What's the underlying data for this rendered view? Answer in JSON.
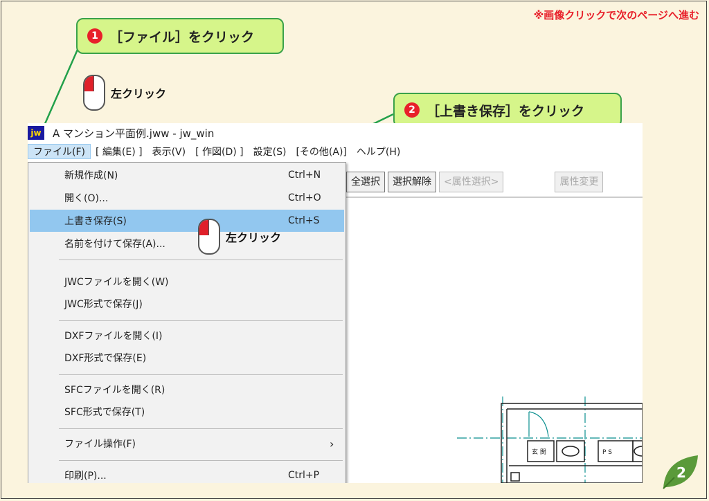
{
  "note": "※画像クリックで次のページへ進む",
  "callout1": {
    "num": "1",
    "text": "［ファイル］をクリック"
  },
  "callout2": {
    "num": "2",
    "text": "［上書き保存］をクリック"
  },
  "mouse_label": "左クリック",
  "window": {
    "icon": "jw",
    "title": "A マンション平面例.jww - jw_win",
    "menu": [
      "ファイル(F)",
      "[ 編集(E) ]",
      "表示(V)",
      "[ 作図(D) ]",
      "設定(S)",
      "[その他(A)]",
      "ヘルプ(H)"
    ]
  },
  "toolbar": [
    "全選択",
    "選択解除",
    "<属性選択>",
    "属性変更"
  ],
  "dropdown": {
    "items": [
      {
        "label": "新規作成(N)",
        "shortcut": "Ctrl+N"
      },
      {
        "label": "開く(O)...",
        "shortcut": "Ctrl+O"
      },
      {
        "label": "上書き保存(S)",
        "shortcut": "Ctrl+S"
      },
      {
        "label": "名前を付けて保存(A)...",
        "shortcut": ""
      },
      {
        "label": "JWCファイルを開く(W)",
        "shortcut": ""
      },
      {
        "label": "JWC形式で保存(J)",
        "shortcut": ""
      },
      {
        "label": "DXFファイルを開く(I)",
        "shortcut": ""
      },
      {
        "label": "DXF形式で保存(E)",
        "shortcut": ""
      },
      {
        "label": "SFCファイルを開く(R)",
        "shortcut": ""
      },
      {
        "label": "SFC形式で保存(T)",
        "shortcut": ""
      },
      {
        "label": "ファイル操作(F)",
        "shortcut": ""
      },
      {
        "label": "印刷(P)...",
        "shortcut": "Ctrl+P"
      }
    ]
  },
  "drawing_labels": [
    "玄 関",
    "P S"
  ],
  "page_number": "2",
  "colors": {
    "callout_bg": "#d6f58a",
    "callout_border": "#3aa14a",
    "highlight": "#92c7ef",
    "note": "#e8202a"
  }
}
